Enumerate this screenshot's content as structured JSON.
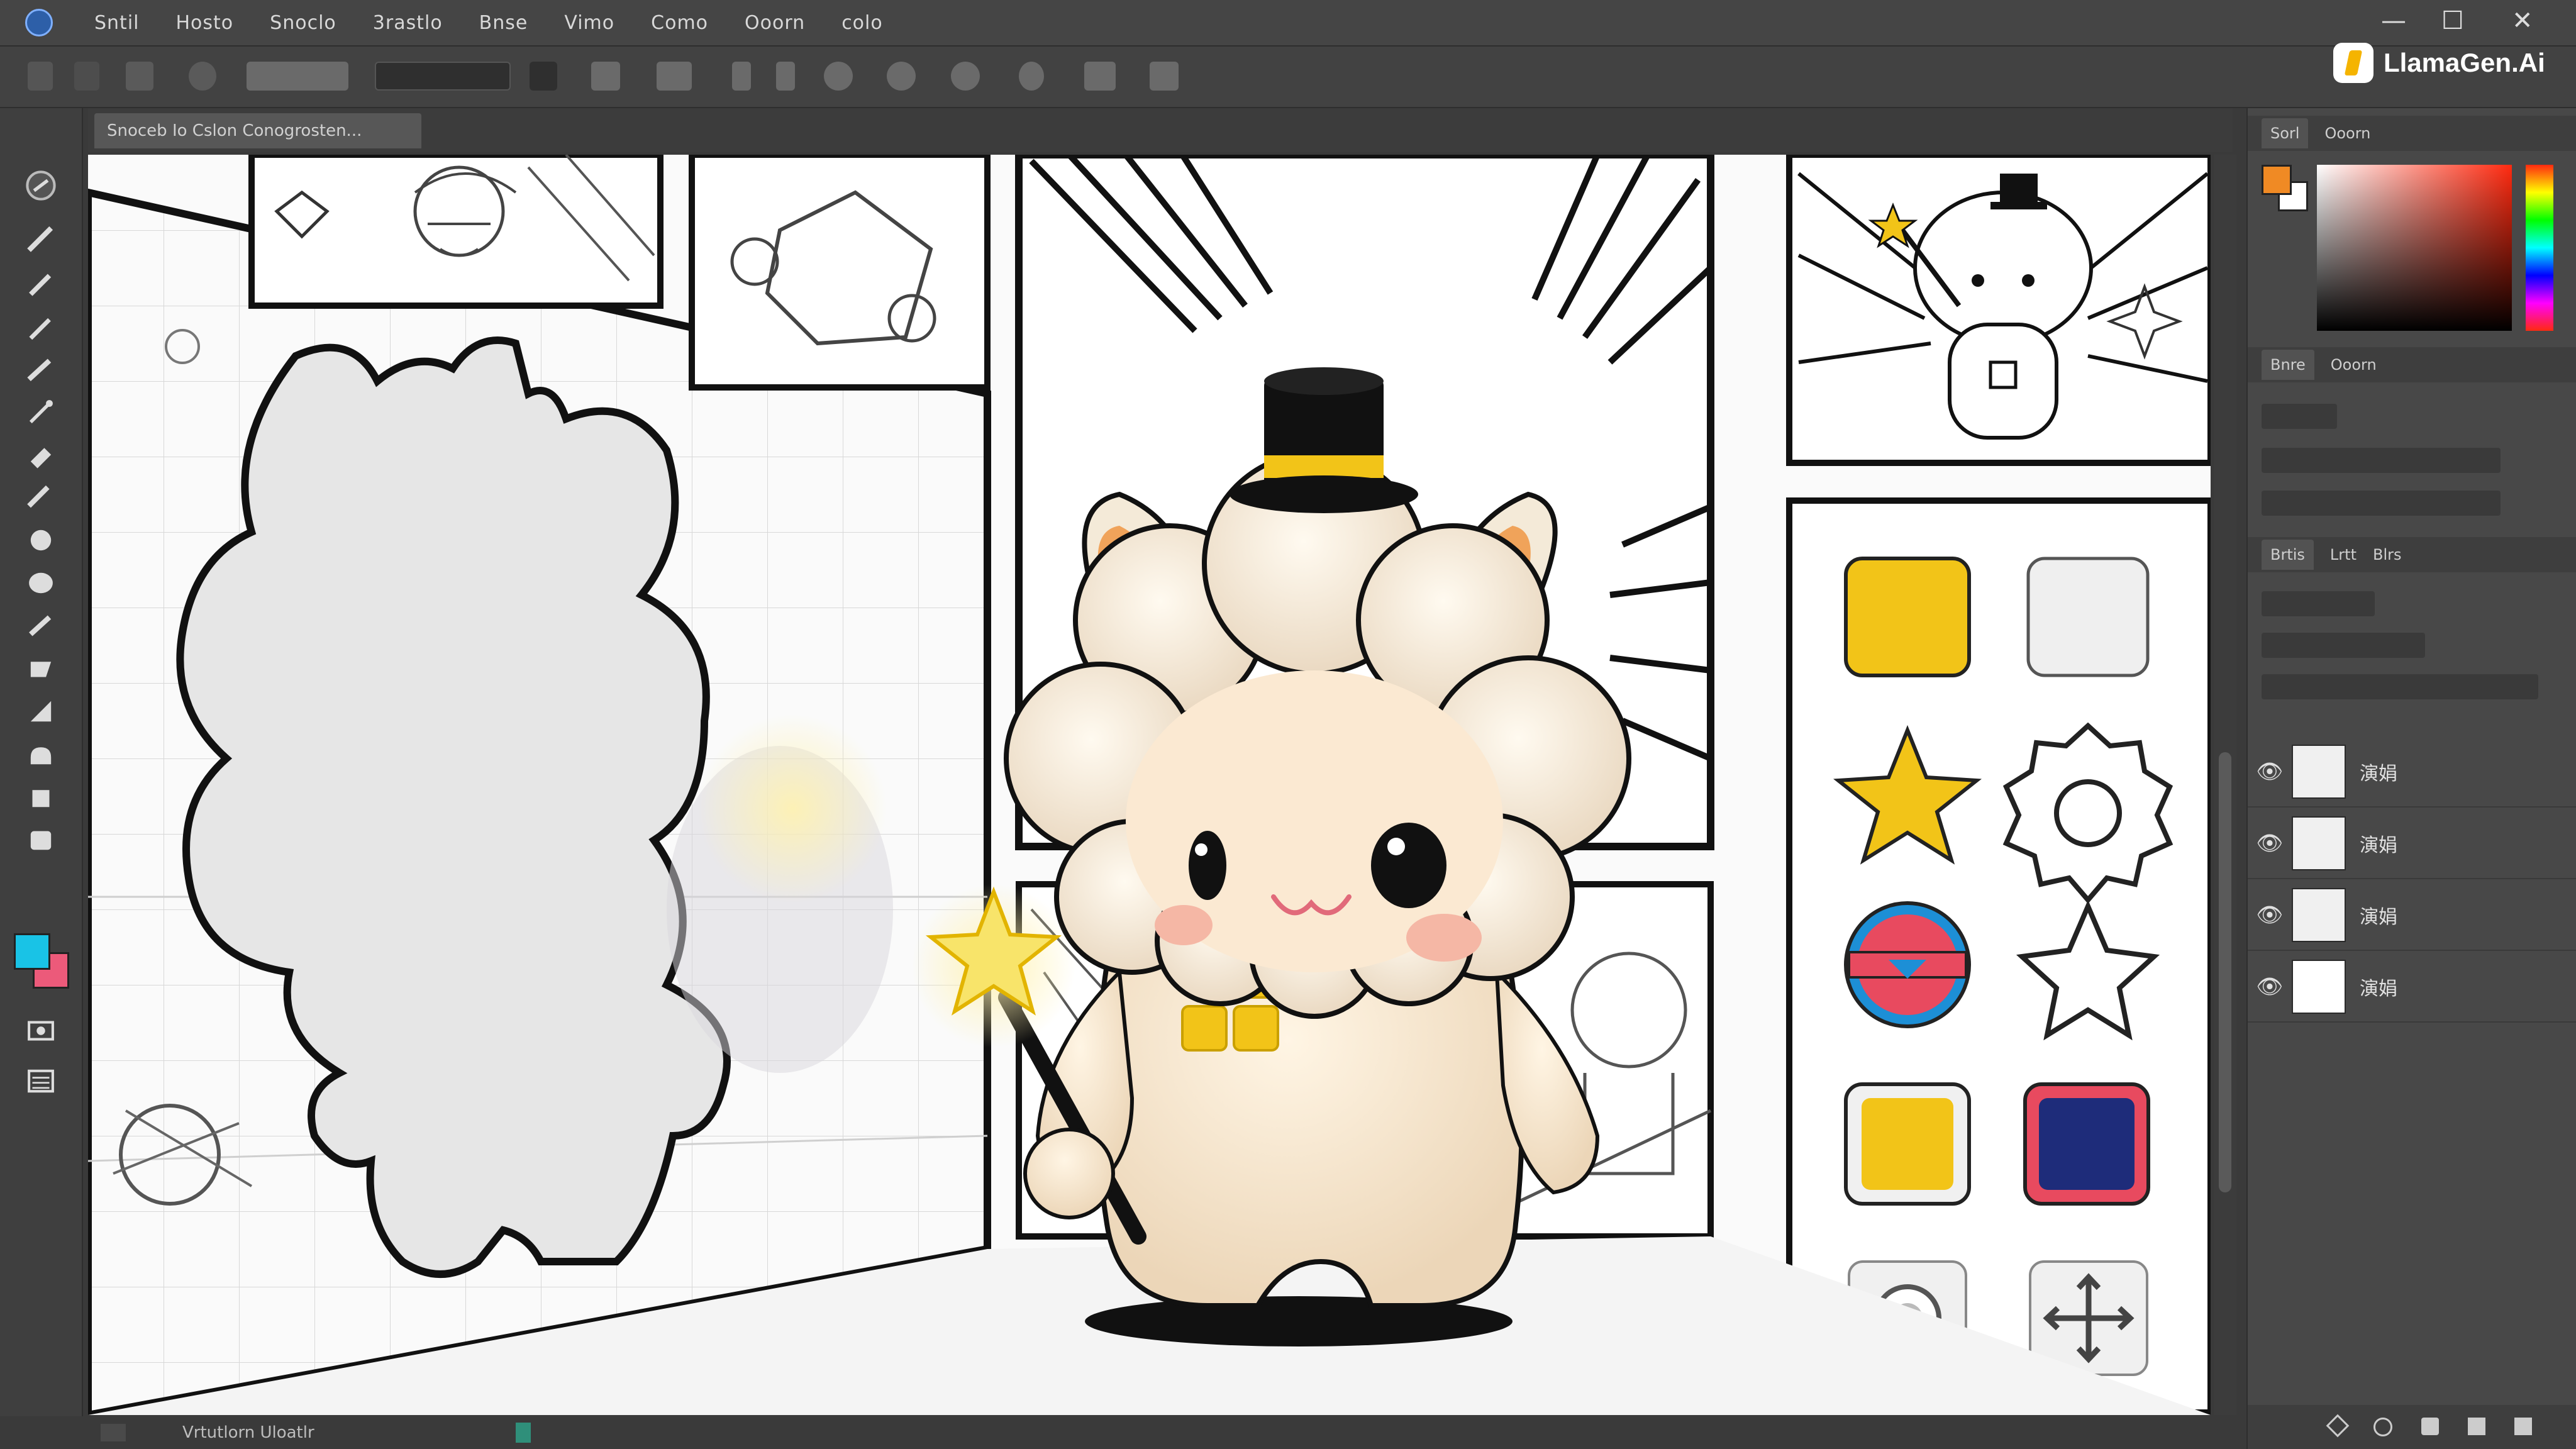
{
  "app": {
    "menu": [
      "Sntil",
      "Hosto",
      "Snoclo",
      "3rastlo",
      "Bnse",
      "Vimo",
      "Como",
      "Ooorn",
      "colo"
    ],
    "window_controls": {
      "minimize": "—",
      "maximize": "☐",
      "close": "✕"
    },
    "brand": "LlamaGen.Ai"
  },
  "document": {
    "tab_title": "Snoceb Io Cslon Conogrosten..."
  },
  "colors": {
    "primary_swatch": "#19c3e6",
    "secondary_swatch": "#ec5a7a",
    "picker_foreground": "#f08a24",
    "picker_background": "#ffffff",
    "accent_yellow": "#f2c418",
    "navy": "#1e2c7a"
  },
  "right_panel": {
    "color_tabs": [
      "Sorl",
      "Ooorn"
    ],
    "swatch_tabs": [
      "Bnre",
      "Ooorn"
    ],
    "layer_tabs": [
      "Brtis",
      "Lrtt",
      "Blrs"
    ],
    "layers": [
      {
        "name": "演娟"
      },
      {
        "name": "演娟"
      },
      {
        "name": "演娟"
      },
      {
        "name": "演娟"
      }
    ]
  },
  "status": {
    "text": "Vrtutlorn Uloatlr"
  },
  "icons": {
    "tools": [
      "lasso-icon",
      "brush-icon",
      "pencil-icon",
      "pen-icon",
      "marker-icon",
      "airbrush-icon",
      "fill-icon",
      "eraser-icon",
      "blend-icon",
      "ellipse-icon",
      "shape-icon",
      "hand-icon",
      "zoom-icon"
    ],
    "sticker_icons": [
      "yellow-square-icon",
      "white-square-icon",
      "yellow-star-icon",
      "gear-outline-icon",
      "ring-badge-icon",
      "star-outline-icon",
      "yellow-square-frame-icon",
      "navy-square-icon",
      "gear-icon",
      "move-arrows-icon"
    ]
  }
}
